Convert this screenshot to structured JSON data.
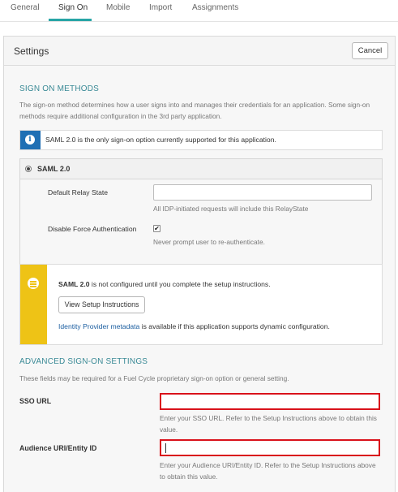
{
  "tabs": [
    {
      "label": "General"
    },
    {
      "label": "Sign On"
    },
    {
      "label": "Mobile"
    },
    {
      "label": "Import"
    },
    {
      "label": "Assignments"
    }
  ],
  "settings": {
    "title": "Settings",
    "cancel_label": "Cancel"
  },
  "sign_on_methods": {
    "heading": "SIGN ON METHODS",
    "description": "The sign-on method determines how a user signs into and manages their credentials for an application. Some sign-on methods require additional configuration in the 3rd party application.",
    "info_text": "SAML 2.0 is the only sign-on option currently supported for this application.",
    "option_label": "SAML 2.0",
    "default_relay_state": {
      "label": "Default Relay State",
      "value": "",
      "hint": "All IDP-initiated requests will include this RelayState"
    },
    "disable_force_auth": {
      "label": "Disable Force Authentication",
      "checked": true,
      "check_glyph": "✔",
      "hint": "Never prompt user to re-authenticate."
    }
  },
  "setup_notice": {
    "bold": "SAML 2.0",
    "text": " is not configured until you complete the setup instructions.",
    "button_label": "View Setup Instructions",
    "link_text": "Identity Provider metadata",
    "link_suffix": " is available if this application supports dynamic configuration."
  },
  "advanced": {
    "heading": "ADVANCED SIGN-ON SETTINGS",
    "description": "These fields may be required for a Fuel Cycle proprietary sign-on option or general setting.",
    "sso_url": {
      "label": "SSO URL",
      "value": "",
      "hint": "Enter your SSO URL. Refer to the Setup Instructions above to obtain this value."
    },
    "audience_uri": {
      "label": "Audience URI/Entity ID",
      "value": "",
      "hint": "Enter your Audience URI/Entity ID. Refer to the Setup Instructions above to obtain this value."
    }
  },
  "colors": {
    "tab_active_underline": "#28a5a6",
    "info_stripe": "#1f6fb4",
    "warning_stripe": "#eec316",
    "highlight_border": "#d9121b",
    "section_heading": "#3a8a96"
  },
  "icons": {
    "info": "info-icon",
    "warning": "list-icon",
    "radio": "radio-selected"
  }
}
